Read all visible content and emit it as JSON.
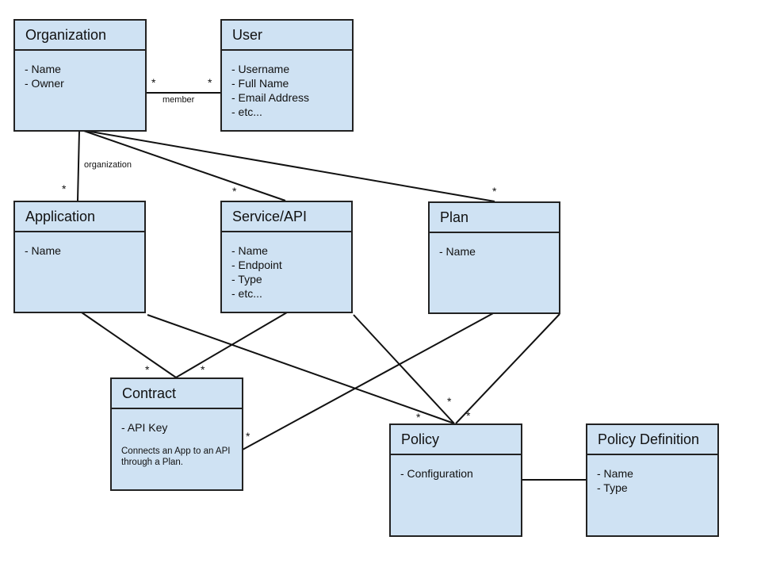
{
  "entities": {
    "organization": {
      "title": "Organization",
      "attrs": [
        "- Name",
        "- Owner"
      ]
    },
    "user": {
      "title": "User",
      "attrs": [
        "- Username",
        "- Full Name",
        "- Email Address",
        "- etc..."
      ]
    },
    "application": {
      "title": "Application",
      "attrs": [
        "- Name"
      ]
    },
    "service": {
      "title": "Service/API",
      "attrs": [
        "- Name",
        "- Endpoint",
        "- Type",
        "- etc..."
      ]
    },
    "plan": {
      "title": "Plan",
      "attrs": [
        "- Name"
      ]
    },
    "contract": {
      "title": "Contract",
      "attrs": [
        "- API Key"
      ],
      "note": "Connects an App to an API through a Plan."
    },
    "policy": {
      "title": "Policy",
      "attrs": [
        "- Configuration"
      ]
    },
    "policy_definition": {
      "title": "Policy Definition",
      "attrs": [
        "- Name",
        "- Type"
      ]
    }
  },
  "relations": {
    "member_label": "member",
    "organization_label": "organization",
    "multiplicity": "*"
  },
  "colors": {
    "box_fill": "#cfe2f3",
    "stroke": "#222222"
  }
}
